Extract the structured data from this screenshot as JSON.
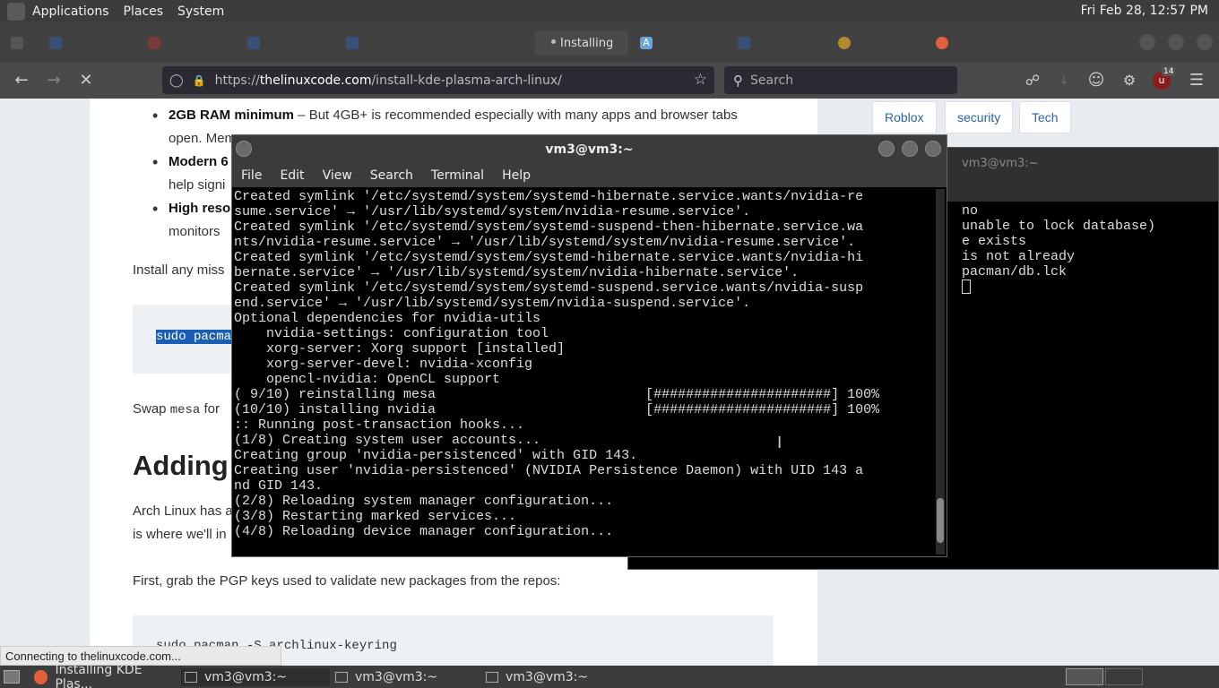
{
  "panel": {
    "applications": "Applications",
    "places": "Places",
    "system": "System",
    "clock": "Fri Feb 28, 12:57 PM"
  },
  "browser": {
    "tabs": [
      {
        "label": "",
        "icon": "blank"
      },
      {
        "label": "",
        "icon": "blank"
      },
      {
        "label": "",
        "icon": "blank"
      },
      {
        "label": "",
        "icon": "blank"
      },
      {
        "label": "",
        "icon": "blank"
      },
      {
        "label": "Installing",
        "icon": "loading-dot"
      },
      {
        "label": "",
        "icon": "font-icon"
      },
      {
        "label": "",
        "icon": "blank"
      },
      {
        "label": "",
        "icon": "blank"
      },
      {
        "label": "",
        "icon": "firefox-icon"
      }
    ],
    "url_prefix": "https://",
    "url_host": "thelinuxcode.com",
    "url_path": "/install-kde-plasma-arch-linux/",
    "search_placeholder": "Search",
    "extension_badge": "14"
  },
  "article": {
    "bullet1_bold": "2GB RAM minimum",
    "bullet1_text": " – But 4GB+ is recommended especially with many apps and browser tabs",
    "bullet1_line2": "open. Mem",
    "bullet2_bold": "Modern 6",
    "bullet2_line2": "help signi",
    "bullet3_bold": "High reso",
    "bullet3_line2": "monitors",
    "install_text": "Install any miss",
    "code1": "sudo pacma",
    "swap_text": "Swap ",
    "swap_code": "mesa",
    "swap_after": " for",
    "heading": "Adding",
    "arch_line1": "Arch Linux has a",
    "arch_line2": "is where we'll in",
    "pgp_text": "First, grab the PGP keys used to validate new packages from the repos:",
    "code2": "sudo pacman -S archlinux-keyring"
  },
  "sidebar_tags": [
    "Roblox",
    "security",
    "Tech"
  ],
  "status_text": "Connecting to thelinuxcode.com...",
  "terminal_main": {
    "title": "vm3@vm3:~",
    "menu": [
      "File",
      "Edit",
      "View",
      "Search",
      "Terminal",
      "Help"
    ],
    "lines": [
      "Created symlink '/etc/systemd/system/systemd-hibernate.service.wants/nvidia-re",
      "sume.service' → '/usr/lib/systemd/system/nvidia-resume.service'.",
      "Created symlink '/etc/systemd/system/systemd-suspend-then-hibernate.service.wa",
      "nts/nvidia-resume.service' → '/usr/lib/systemd/system/nvidia-resume.service'.",
      "Created symlink '/etc/systemd/system/systemd-hibernate.service.wants/nvidia-hi",
      "bernate.service' → '/usr/lib/systemd/system/nvidia-hibernate.service'.",
      "Created symlink '/etc/systemd/system/systemd-suspend.service.wants/nvidia-susp",
      "end.service' → '/usr/lib/systemd/system/nvidia-suspend.service'.",
      "Optional dependencies for nvidia-utils",
      "    nvidia-settings: configuration tool",
      "    xorg-server: Xorg support [installed]",
      "    xorg-server-devel: nvidia-xconfig",
      "    opencl-nvidia: OpenCL support",
      "( 9/10) reinstalling mesa                          [######################] 100%",
      "(10/10) installing nvidia                          [######################] 100%",
      ":: Running post-transaction hooks...",
      "(1/8) Creating system user accounts...",
      "Creating group 'nvidia-persistenced' with GID 143.",
      "Creating user 'nvidia-persistenced' (NVIDIA Persistence Daemon) with UID 143 a",
      "nd GID 143.",
      "(2/8) Reloading system manager configuration...",
      "(3/8) Restarting marked services...",
      "(4/8) Reloading device manager configuration..."
    ]
  },
  "terminal_back": {
    "title": "vm3@vm3:~",
    "lines": [
      "no",
      "unable to lock database)",
      "e exists",
      "is not already",
      "pacman/db.lck"
    ]
  },
  "taskbar": {
    "items": [
      {
        "label": "Installing KDE Plas...",
        "icon": "firefox-icon"
      },
      {
        "label": "vm3@vm3:~",
        "icon": "terminal-icon"
      },
      {
        "label": "vm3@vm3:~",
        "icon": "terminal-icon"
      },
      {
        "label": "vm3@vm3:~",
        "icon": "terminal-icon"
      }
    ]
  }
}
